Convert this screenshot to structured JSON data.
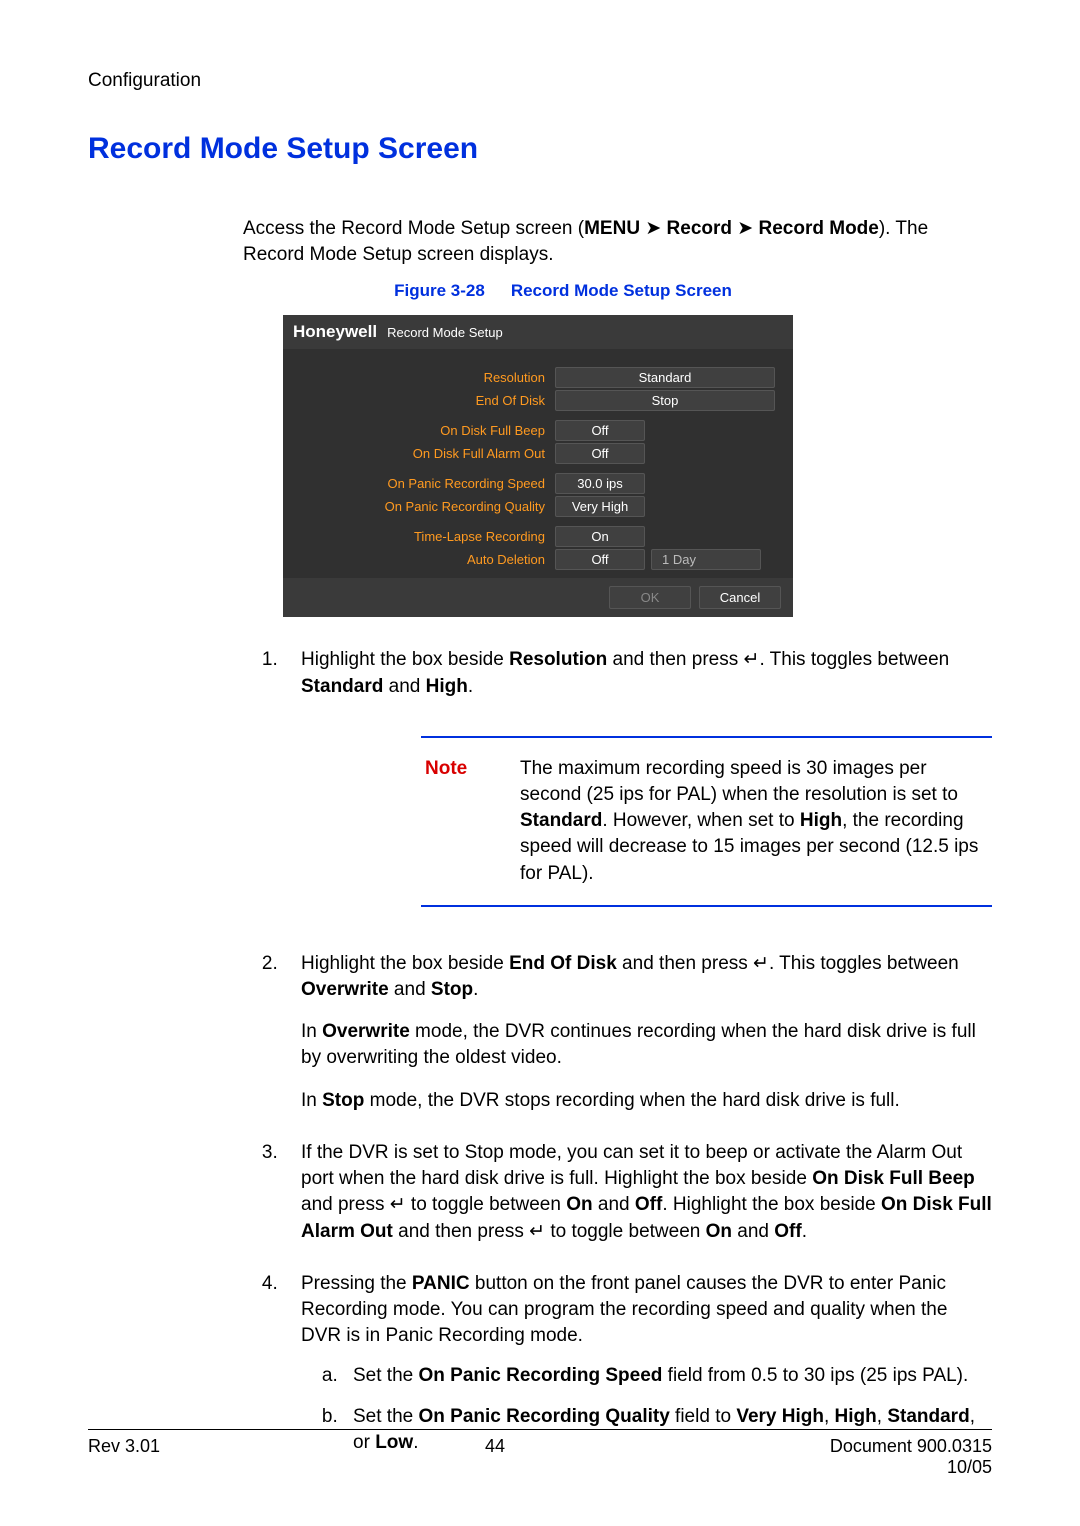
{
  "header": {
    "section": "Configuration"
  },
  "title": "Record Mode Setup Screen",
  "intro": {
    "line1a": "Access the Record Mode Setup screen (",
    "menu": "MENU",
    "arrow": "➤",
    "record": "Record",
    "recordmode": "Record Mode",
    "line1b": "). The Record Mode Setup screen displays."
  },
  "figure": {
    "label": "Figure 3-28",
    "title": "Record Mode Setup Screen"
  },
  "screenshot": {
    "brand": "Honeywell",
    "window_title": "Record Mode Setup",
    "rows": {
      "resolution": {
        "label": "Resolution",
        "value": "Standard"
      },
      "end_of_disk": {
        "label": "End Of Disk",
        "value": "Stop"
      },
      "disk_beep": {
        "label": "On Disk Full Beep",
        "value": "Off"
      },
      "disk_alarm": {
        "label": "On Disk Full Alarm Out",
        "value": "Off"
      },
      "panic_speed": {
        "label": "On Panic Recording Speed",
        "value": "30.0 ips"
      },
      "panic_qual": {
        "label": "On Panic Recording Quality",
        "value": "Very High"
      },
      "timelapse": {
        "label": "Time-Lapse Recording",
        "value": "On"
      },
      "auto_del": {
        "label": "Auto Deletion",
        "value": "Off",
        "value2": "1 Day"
      }
    },
    "ok": "OK",
    "cancel": "Cancel"
  },
  "step1": {
    "t1": "Highlight the box beside ",
    "b1": "Resolution",
    "t2": " and then press ",
    "enter": "↵",
    "t3": ". This toggles between ",
    "b2": "Standard",
    "t4": " and ",
    "b3": "High",
    "t5": "."
  },
  "note": {
    "label": "Note",
    "t1": "The maximum recording speed is 30 images per second (25 ips for PAL) when the resolution is set to ",
    "b1": "Standard",
    "t2": ". However, when set to ",
    "b2": "High",
    "t3": ", the recording speed will decrease to 15 images per second (12.5 ips for PAL)."
  },
  "step2": {
    "t1": "Highlight the box beside ",
    "b1": "End Of Disk",
    "t2": " and then press ",
    "enter": "↵",
    "t3": ". This toggles between ",
    "b2": "Overwrite",
    "t4": " and ",
    "b3": "Stop",
    "t5": ".",
    "p2a": "In ",
    "p2b": "Overwrite",
    "p2c": " mode, the DVR continues recording when the hard disk drive is full by overwriting the oldest video.",
    "p3a": "In ",
    "p3b": "Stop",
    "p3c": " mode, the DVR stops recording when the hard disk drive is full."
  },
  "step3": {
    "t1": "If the DVR is set to Stop mode, you can set it to beep or activate the Alarm Out port when the hard disk drive is full. Highlight the box beside ",
    "b1": "On Disk Full Beep",
    "t2": " and press ",
    "enter": "↵",
    "t3": " to toggle between ",
    "b2": "On",
    "t4": " and ",
    "b3": "Off",
    "t5": ". Highlight the box beside ",
    "b4": "On Disk Full Alarm Out",
    "t6": " and then press ",
    "t7": " to toggle between ",
    "b5": "On",
    "t8": " and ",
    "b6": "Off",
    "t9": "."
  },
  "step4": {
    "t1": "Pressing the ",
    "b1": "PANIC",
    "t2": " button on the front panel causes the DVR to enter Panic Recording mode. You can program the recording speed and quality when the DVR is in Panic Recording mode.",
    "a_t1": "Set the ",
    "a_b1": "On Panic Recording Speed",
    "a_t2": " field from 0.5 to 30 ips (25 ips PAL).",
    "b_t1": "Set the ",
    "b_b1": "On Panic Recording Quality",
    "b_t2": " field to ",
    "b_b2": "Very High",
    "b_t3": ", ",
    "b_b3": "High",
    "b_t4": ", ",
    "b_b4": "Standard",
    "b_t5": ", or ",
    "b_b5": "Low",
    "b_t6": "."
  },
  "footer": {
    "rev": "Rev 3.01",
    "page": "44",
    "doc": "Document 900.0315",
    "date": "10/05"
  }
}
